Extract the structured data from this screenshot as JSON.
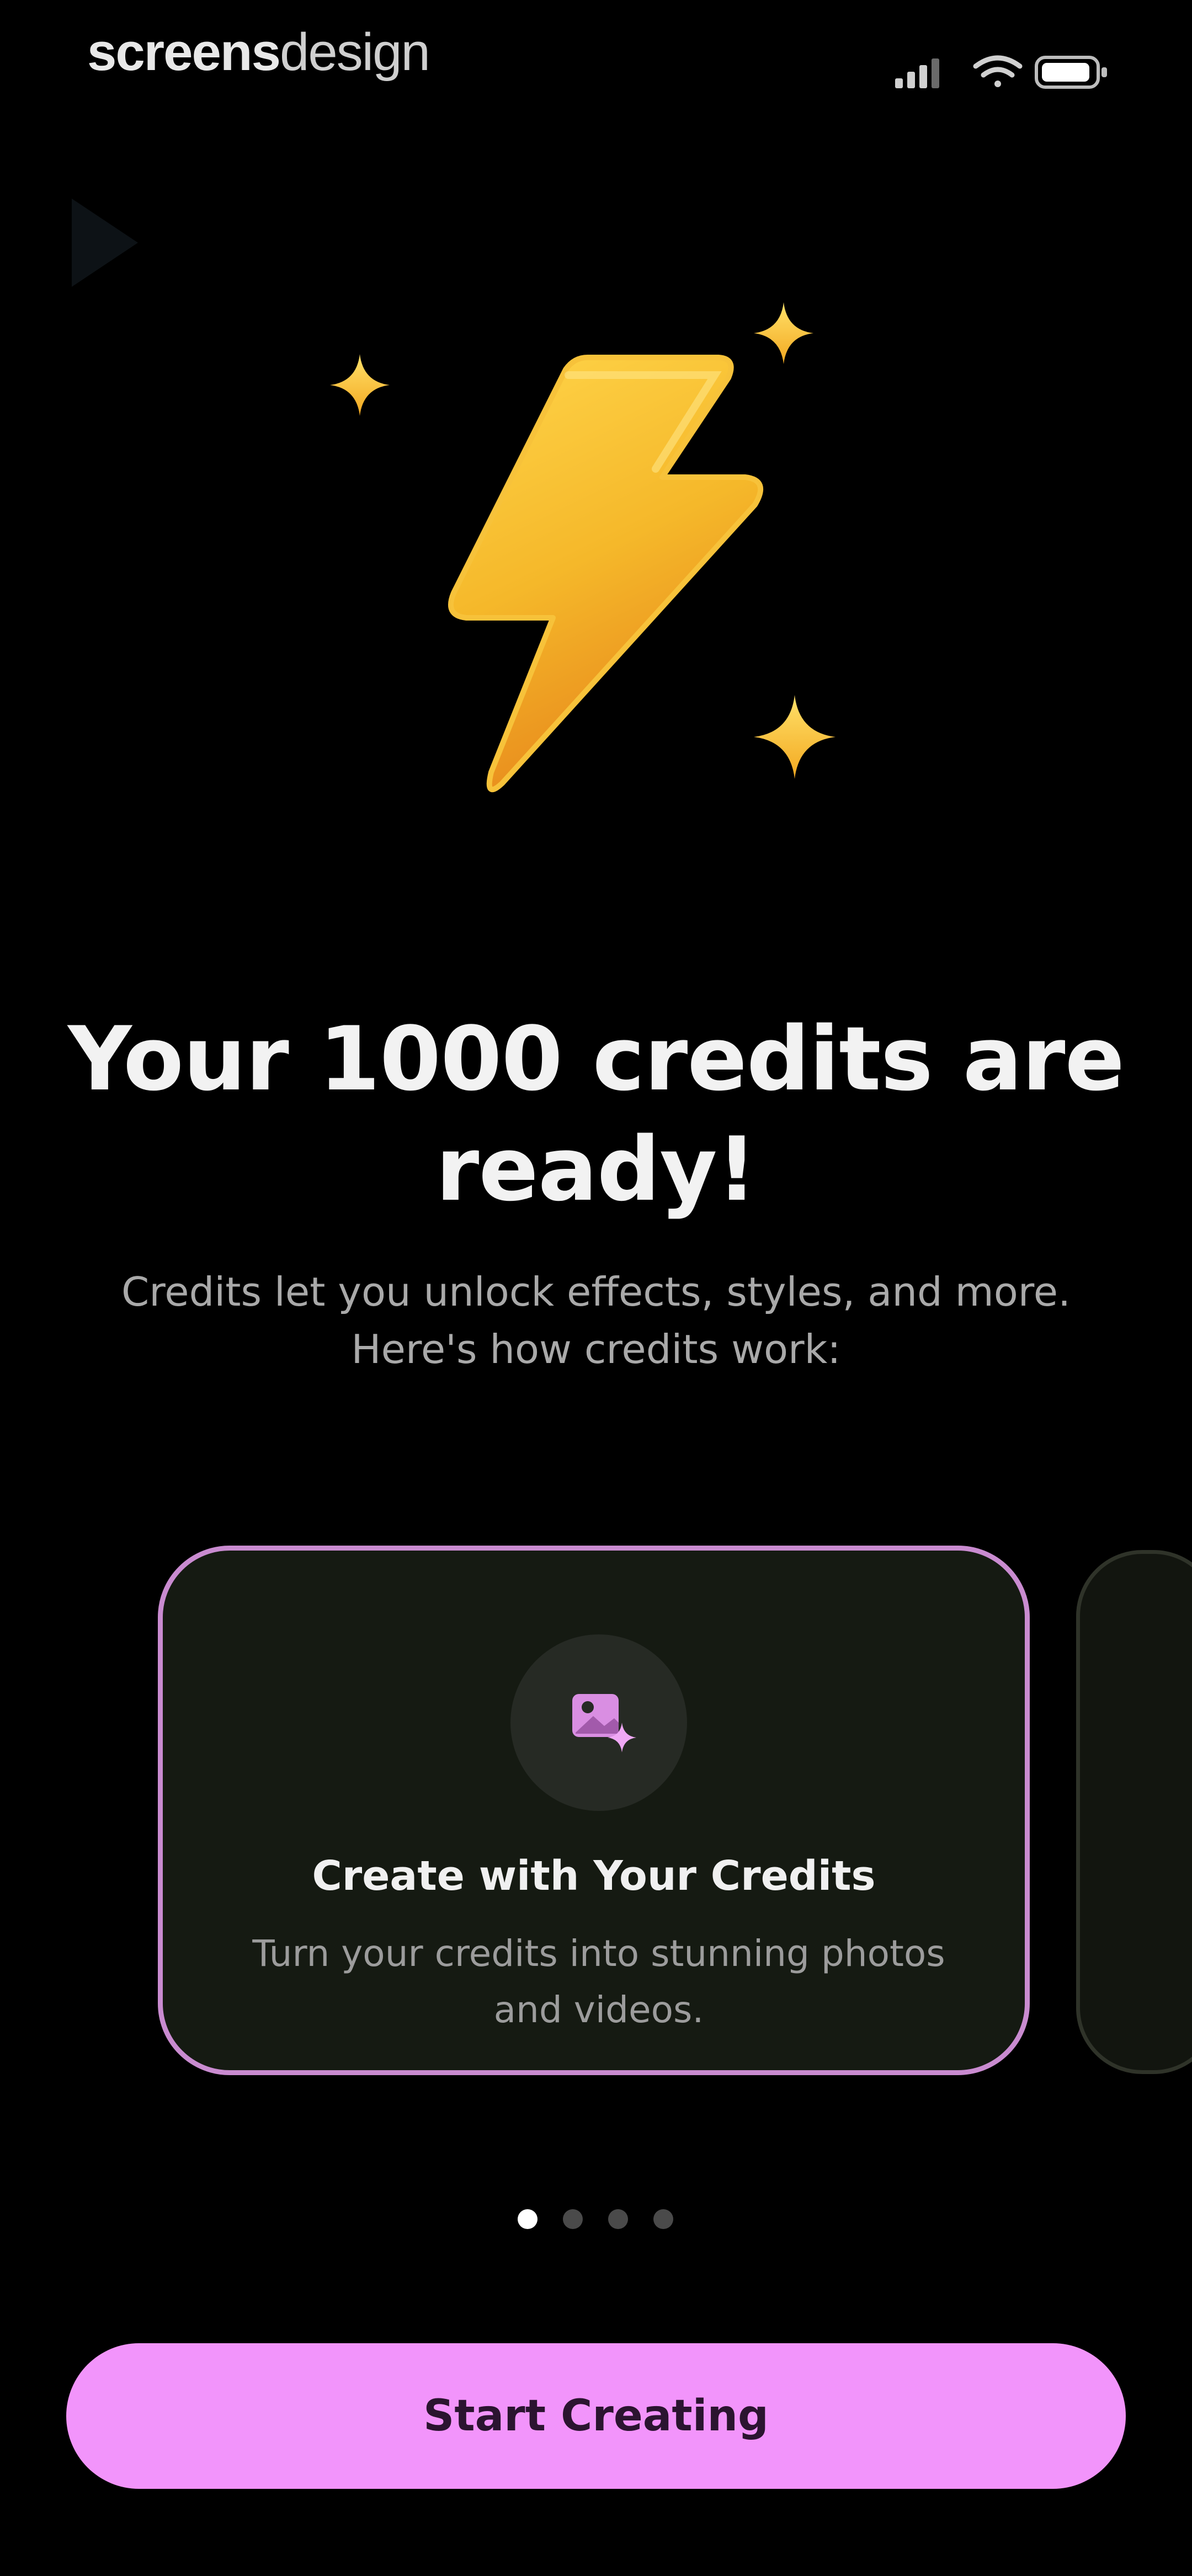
{
  "watermark": {
    "part1": "screens",
    "part2": "design"
  },
  "icons": {
    "back": "play-triangle-icon",
    "hero": "lightning-bolt-icon",
    "sparkles": "sparkle-icon",
    "card": "image-sparkle-icon",
    "signal": "cellular-signal-icon",
    "wifi": "wifi-icon",
    "battery": "battery-icon"
  },
  "header": {
    "title": "Your 1000 credits are ready!",
    "subtitle_line1": "Credits let you unlock effects, styles, and more.",
    "subtitle_line2": "Here's how credits work:"
  },
  "carousel": {
    "cards": [
      {
        "title": "Create with Your Credits",
        "description": "Turn your credits into stunning photos and videos."
      }
    ],
    "page_count": 4,
    "active_page": 1
  },
  "cta": {
    "label": "Start Creating"
  },
  "colors": {
    "background": "#000000",
    "accent": "#f294fb",
    "card_border": "#c98bd0",
    "card_background": "#151a12",
    "bolt_yellow": "#f5b82a"
  }
}
